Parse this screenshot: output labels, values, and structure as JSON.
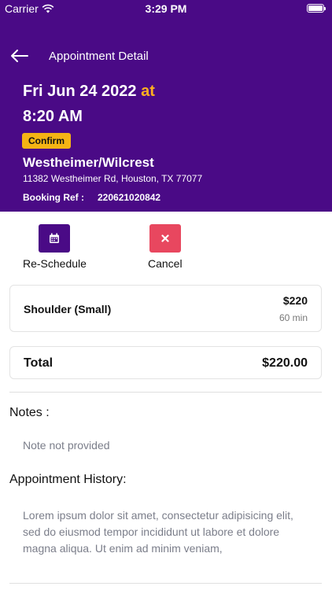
{
  "status_bar": {
    "carrier": "Carrier",
    "time": "3:29 PM"
  },
  "nav": {
    "title": "Appointment Detail"
  },
  "appointment": {
    "date": "Fri Jun 24 2022",
    "at": "at",
    "time": "8:20 AM",
    "status": "Confirm",
    "location_name": "Westheimer/Wilcrest",
    "address": "11382 Westheimer Rd, Houston, TX 77077",
    "booking_ref_label": "Booking Ref :",
    "booking_ref": "220621020842"
  },
  "actions": {
    "reschedule": "Re-Schedule",
    "cancel": "Cancel"
  },
  "service": {
    "name": "Shoulder (Small)",
    "price": "$220",
    "duration": "60 min"
  },
  "total": {
    "label": "Total",
    "value": "$220.00"
  },
  "notes": {
    "title": "Notes :",
    "text": "Note not provided"
  },
  "history": {
    "title": "Appointment History:",
    "lines": [
      "Lorem ipsum dolor sit amet, consectetur adipisicing elit,",
      "sed do eiusmod tempor incididunt ut labore et dolore",
      "magna aliqua. Ut enim ad minim veniam,"
    ]
  },
  "colors": {
    "header": "#4a0a86",
    "accent": "#ffb020",
    "badge": "#f5b414",
    "cancel": "#e8475f"
  },
  "icons": {
    "back": "arrow-left-icon",
    "calendar": "calendar-icon",
    "close": "close-icon",
    "wifi": "wifi-icon",
    "battery": "battery-icon"
  }
}
